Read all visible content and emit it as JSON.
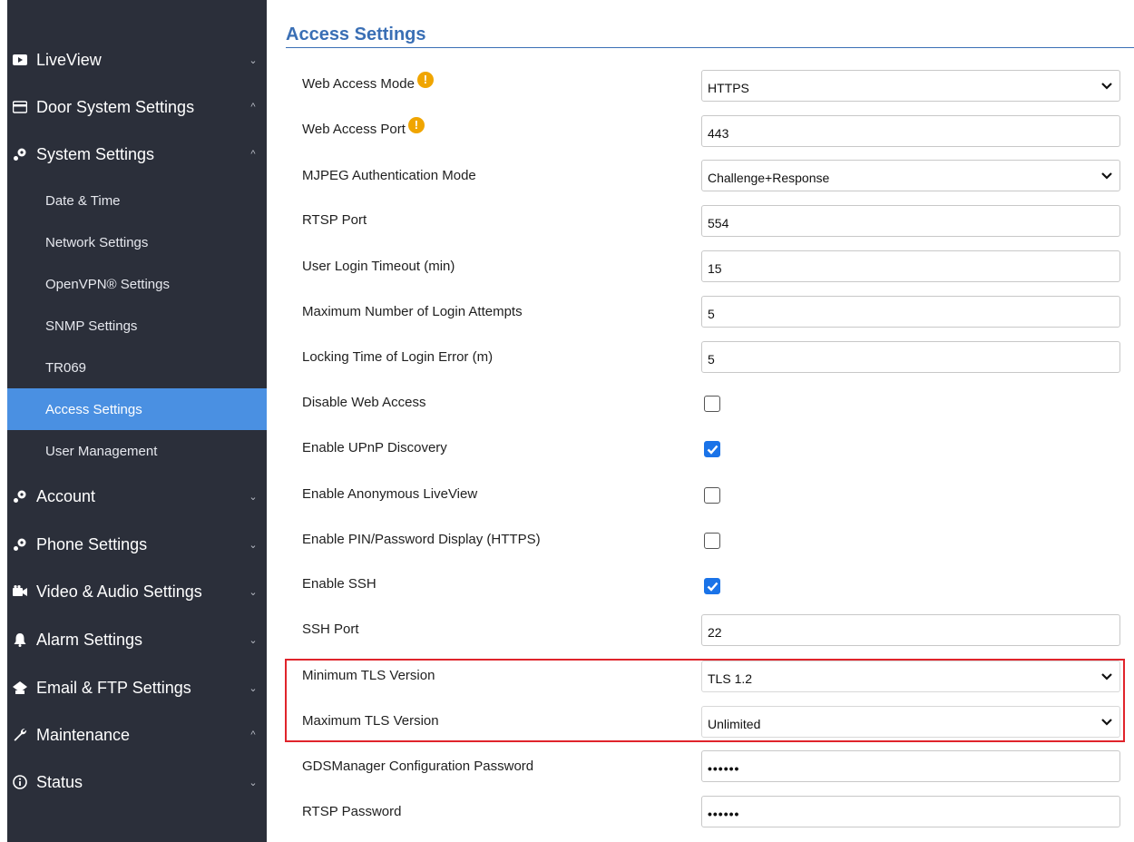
{
  "sidebar": {
    "top_items": [
      {
        "label": "LiveView",
        "icon": "video-icon",
        "chevron": "⌄"
      },
      {
        "label": "Door System Settings",
        "icon": "panel-icon",
        "chevron": "^"
      },
      {
        "label": "System Settings",
        "icon": "settings-icon",
        "chevron": "^"
      }
    ],
    "sub_items": [
      {
        "label": "Date & Time"
      },
      {
        "label": "Network Settings"
      },
      {
        "label": "OpenVPN® Settings"
      },
      {
        "label": "SNMP Settings"
      },
      {
        "label": "TR069"
      },
      {
        "label": "Access Settings",
        "active": true
      },
      {
        "label": "User Management"
      }
    ],
    "bottom_items": [
      {
        "label": "Account",
        "icon": "settings-icon",
        "chevron": "⌄"
      },
      {
        "label": "Phone Settings",
        "icon": "settings-icon",
        "chevron": "⌄"
      },
      {
        "label": "Video & Audio Settings",
        "icon": "video-audio-icon",
        "chevron": "⌄"
      },
      {
        "label": "Alarm Settings",
        "icon": "bell-icon",
        "chevron": "⌄"
      },
      {
        "label": "Email & FTP Settings",
        "icon": "email-icon",
        "chevron": "⌄"
      },
      {
        "label": "Maintenance",
        "icon": "wrench-icon",
        "chevron": "^"
      },
      {
        "label": "Status",
        "icon": "info-icon",
        "chevron": "⌄"
      }
    ]
  },
  "page": {
    "title": "Access Settings"
  },
  "rows": [
    {
      "label": "Web Access Mode",
      "type": "select",
      "value": "HTTPS",
      "warning": true
    },
    {
      "label": "Web Access Port",
      "type": "input",
      "value": "443",
      "warning": true
    },
    {
      "label": "MJPEG Authentication Mode",
      "type": "select",
      "value": "Challenge+Response"
    },
    {
      "label": "RTSP Port",
      "type": "input",
      "value": "554"
    },
    {
      "label": "User Login Timeout (min)",
      "type": "input",
      "value": "15"
    },
    {
      "label": "Maximum Number of Login Attempts",
      "type": "input",
      "value": "5"
    },
    {
      "label": "Locking Time of Login Error (m)",
      "type": "input",
      "value": "5"
    },
    {
      "label": "Disable Web Access",
      "type": "checkbox",
      "checked": false
    },
    {
      "label": "Enable UPnP Discovery",
      "type": "checkbox",
      "checked": true
    },
    {
      "label": "Enable Anonymous LiveView",
      "type": "checkbox",
      "checked": false
    },
    {
      "label": "Enable PIN/Password Display (HTTPS)",
      "type": "checkbox",
      "checked": false
    },
    {
      "label": "Enable SSH",
      "type": "checkbox",
      "checked": true
    },
    {
      "label": "SSH Port",
      "type": "input",
      "value": "22"
    },
    {
      "label": "Minimum TLS Version",
      "type": "select",
      "value": "TLS 1.2"
    },
    {
      "label": "Maximum TLS Version",
      "type": "select",
      "value": "Unlimited"
    },
    {
      "label": "GDSManager Configuration Password",
      "type": "password",
      "value": "••••••"
    },
    {
      "label": "RTSP Password",
      "type": "password",
      "value": "••••••"
    }
  ],
  "warning_glyph": "!",
  "colors": {
    "sidebar_bg": "#2b2f3a",
    "active_item": "#4a90e2",
    "title": "#3a6fb5",
    "warning": "#f0a500",
    "checkbox_checked": "#1a73e8",
    "highlight_border": "#e0242b"
  }
}
